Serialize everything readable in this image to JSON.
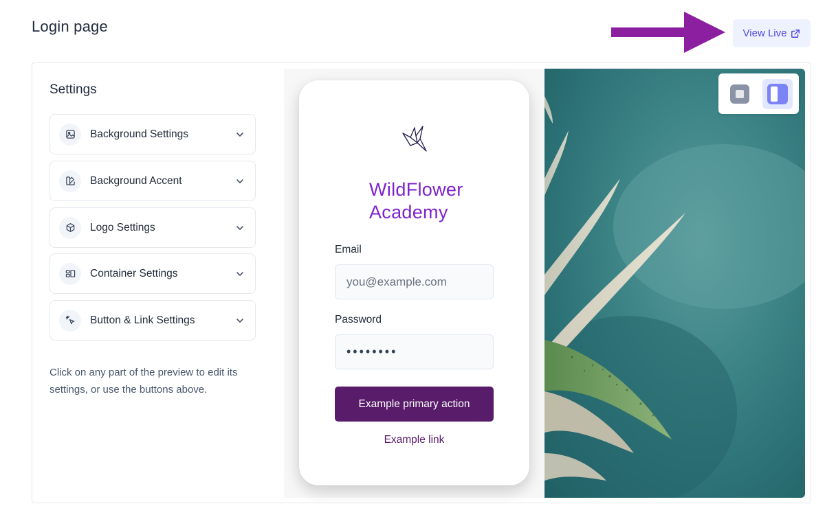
{
  "page": {
    "title": "Login page"
  },
  "header": {
    "view_live_label": "View Live"
  },
  "settings": {
    "heading": "Settings",
    "items": [
      {
        "label": "Background Settings",
        "icon": "image-icon"
      },
      {
        "label": "Background Accent",
        "icon": "palette-icon"
      },
      {
        "label": "Logo Settings",
        "icon": "cube-icon"
      },
      {
        "label": "Container Settings",
        "icon": "layout-icon"
      },
      {
        "label": "Button & Link Settings",
        "icon": "pointer-click-icon"
      }
    ],
    "hint": "Click on any part of the preview to edit its settings, or use the buttons above."
  },
  "preview": {
    "brand_name": "WildFlower Academy",
    "email_label": "Email",
    "email_placeholder": "you@example.com",
    "password_label": "Password",
    "password_value": "••••••••",
    "primary_button": "Example primary action",
    "link_text": "Example link"
  },
  "colors": {
    "brand": "#7e22ce",
    "primary_button": "#581c6a",
    "accent": "#4f46e5",
    "arrow": "#8b1fa0"
  }
}
